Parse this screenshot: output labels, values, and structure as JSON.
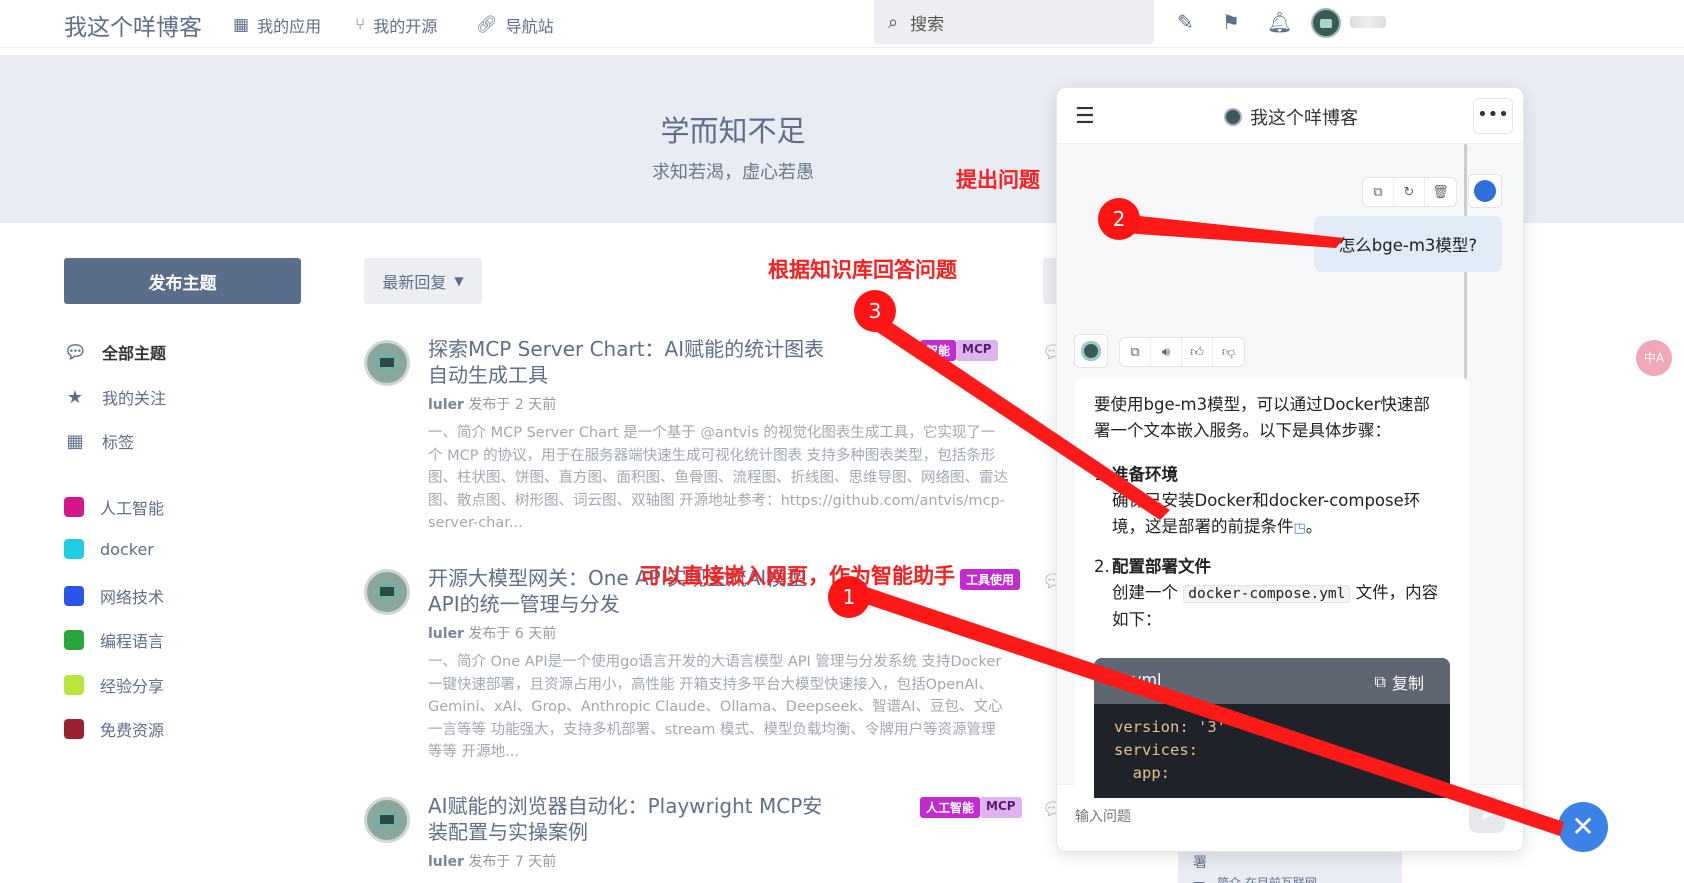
{
  "site": {
    "title": "我这个咩博客"
  },
  "nav": [
    {
      "label": "我的应用",
      "icon": "grid-icon"
    },
    {
      "label": "我的开源",
      "icon": "branch-icon"
    },
    {
      "label": "导航站",
      "icon": "link-icon"
    }
  ],
  "search": {
    "placeholder": "搜索"
  },
  "banner": {
    "title": "学而知不足",
    "subtitle": "求知若渴，虚心若愚"
  },
  "sidebar": {
    "publish": "发布主题",
    "links": [
      {
        "label": "全部主题",
        "icon": "comments-icon"
      },
      {
        "label": "我的关注",
        "icon": "star-icon"
      },
      {
        "label": "标签",
        "icon": "tags-grid-icon"
      }
    ],
    "tags": [
      {
        "label": "人工智能",
        "color": "#d6168a"
      },
      {
        "label": "docker",
        "color": "#21cde0"
      },
      {
        "label": "网络技术",
        "color": "#2a55e6"
      },
      {
        "label": "编程语言",
        "color": "#2aa63a"
      },
      {
        "label": "经验分享",
        "color": "#b9e63a"
      },
      {
        "label": "免费资源",
        "color": "#9a2131"
      }
    ]
  },
  "sort": {
    "label": "最新回复"
  },
  "posts": [
    {
      "title": "探索MCP Server Chart：AI赋能的统计图表自动生成工具",
      "author": "luler",
      "time": "发布于 2 天前",
      "excerpt": "一、简介 MCP Server Chart 是一个基于 @antvis 的视觉化图表生成工具，它实现了一个 MCP 的协议，用于在服务器端快速生成可视化统计图表 支持多种图表类型，包括条形图、柱状图、饼图、直方图、面积图、鱼骨图、流程图、折线图、思维导图、网络图、雷达图、散点图、树形图、词云图、双轴图 开源地址参考：https://github.com/antvis/mcp-server-char...",
      "badges": [
        "智能",
        "MCP"
      ]
    },
    {
      "title": "开源大模型网关：One API实现主流AI模型API的统一管理与分发",
      "author": "luler",
      "time": "发布于 6 天前",
      "excerpt": "一、简介 One API是一个使用go语言开发的大语言模型 API 管理与分发系统 支持Docker一键快速部署，且资源占用小，高性能 开箱支持多平台大模型快速接入，包括OpenAI、Gemini、xAI、Grop、Anthropic Claude、Ollama、Deepseek、智谱AI、豆包、文心一言等等 功能强大，支持多机部署、stream 模式、模型负载均衡、令牌用户等资源管理等等 开源地...",
      "badges": [
        "工具使用"
      ]
    },
    {
      "title": "AI赋能的浏览器自动化：Playwright MCP安装配置与实操案例",
      "author": "luler",
      "time": "发布于 7 天前",
      "excerpt": "",
      "badges": [
        "人工智能",
        "MCP"
      ]
    }
  ],
  "chat": {
    "title": "我这个咩博客",
    "user_message": "怎么bge-m3模型?",
    "bot_intro": "要使用bge-m3模型，可以通过Docker快速部署一个文本嵌入服务。以下是具体步骤：",
    "steps": [
      {
        "num": "1.",
        "head": "准备环境",
        "body": "确保已安装Docker和docker-compose环境，这是部署的前提条件"
      },
      {
        "num": "2.",
        "head": "配置部署文件",
        "body_pre": "创建一个",
        "body_code": "docker-compose.yml",
        "body_post": "文件，内容如下："
      }
    ],
    "code": {
      "lang": "yml",
      "copy": "复制",
      "lines": [
        "version: '3'",
        "services:",
        "  app:"
      ]
    },
    "input_placeholder": "输入问题",
    "behind_text": "署",
    "behind_text2": "一、简介  在目前互联网..."
  },
  "annotations": {
    "a1": "提出问题",
    "a2": "根据知识库回答问题",
    "a3": "可以直接嵌入网页，作为智能助手",
    "n1": "1",
    "n2": "2",
    "n3": "3"
  }
}
